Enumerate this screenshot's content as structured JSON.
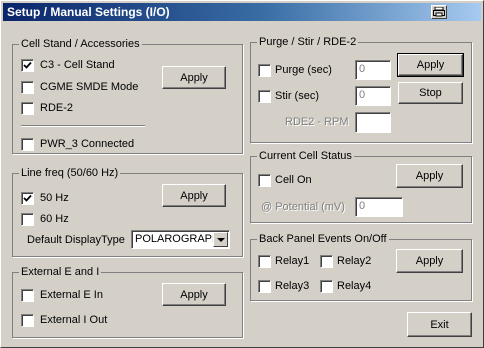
{
  "window": {
    "title": "Setup / Manual Settings (I/O)"
  },
  "cell_stand": {
    "title": "Cell Stand / Accessories",
    "c3_label": "C3 - Cell Stand",
    "c3_checked": true,
    "cgme_label": "CGME SMDE Mode",
    "cgme_checked": false,
    "rde2_label": "RDE-2",
    "rde2_checked": false,
    "pwr3_label": "PWR_3 Connected",
    "pwr3_checked": false,
    "apply_label": "Apply"
  },
  "line_freq": {
    "title": "Line freq (50/60 Hz)",
    "hz50_label": "50 Hz",
    "hz50_checked": true,
    "hz60_label": "60 Hz",
    "hz60_checked": false,
    "display_type_label": "Default DisplayType",
    "display_type_value": "POLAROGRAPHY",
    "apply_label": "Apply"
  },
  "external": {
    "title": "External E and I",
    "e_in_label": "External E In",
    "e_in_checked": false,
    "i_out_label": "External I Out",
    "i_out_checked": false,
    "apply_label": "Apply"
  },
  "purge": {
    "title": "Purge / Stir / RDE-2",
    "purge_label": "Purge (sec)",
    "purge_checked": false,
    "purge_value": "0",
    "stir_label": "Stir (sec)",
    "stir_checked": false,
    "stir_value": "0",
    "rpm_label": "RDE2 - RPM",
    "rpm_value": "",
    "apply_label": "Apply",
    "stop_label": "Stop"
  },
  "cell_status": {
    "title": "Current Cell Status",
    "cell_on_label": "Cell On",
    "cell_on_checked": false,
    "potential_label": "@ Potential (mV)",
    "potential_value": "0",
    "apply_label": "Apply"
  },
  "back_panel": {
    "title": "Back Panel Events On/Off",
    "relay1_label": "Relay1",
    "relay2_label": "Relay2",
    "relay3_label": "Relay3",
    "relay4_label": "Relay4",
    "apply_label": "Apply"
  },
  "exit_label": "Exit",
  "icons": {
    "checkmark": "checkmark-icon",
    "dropdown": "chevron-down-icon",
    "system": "printer-icon"
  }
}
